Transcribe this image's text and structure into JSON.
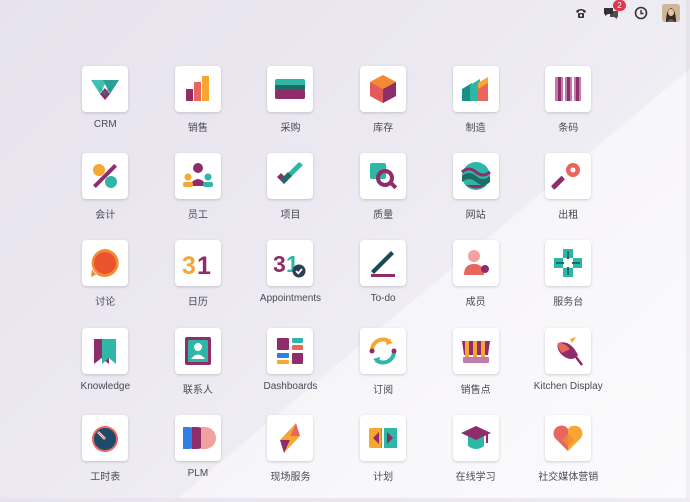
{
  "topbar": {
    "messages_count": "2"
  },
  "apps": [
    {
      "label": "CRM",
      "icon": "crm-icon"
    },
    {
      "label": "销售",
      "icon": "sales-icon"
    },
    {
      "label": "采购",
      "icon": "purchase-icon"
    },
    {
      "label": "库存",
      "icon": "inventory-icon"
    },
    {
      "label": "制造",
      "icon": "manufacturing-icon"
    },
    {
      "label": "条码",
      "icon": "barcode-icon"
    },
    {
      "label": "会计",
      "icon": "accounting-icon"
    },
    {
      "label": "员工",
      "icon": "employees-icon"
    },
    {
      "label": "项目",
      "icon": "project-icon"
    },
    {
      "label": "质量",
      "icon": "quality-icon"
    },
    {
      "label": "网站",
      "icon": "website-icon"
    },
    {
      "label": "出租",
      "icon": "rental-icon"
    },
    {
      "label": "讨论",
      "icon": "discuss-icon"
    },
    {
      "label": "日历",
      "icon": "calendar-icon"
    },
    {
      "label": "Appointments",
      "icon": "appointments-icon"
    },
    {
      "label": "To-do",
      "icon": "todo-icon"
    },
    {
      "label": "成员",
      "icon": "members-icon"
    },
    {
      "label": "服务台",
      "icon": "helpdesk-icon"
    },
    {
      "label": "Knowledge",
      "icon": "knowledge-icon"
    },
    {
      "label": "联系人",
      "icon": "contacts-icon"
    },
    {
      "label": "Dashboards",
      "icon": "dashboards-icon"
    },
    {
      "label": "订阅",
      "icon": "subscriptions-icon"
    },
    {
      "label": "销售点",
      "icon": "point-of-sale-icon"
    },
    {
      "label": "Kitchen Display",
      "icon": "kitchen-display-icon"
    },
    {
      "label": "工时表",
      "icon": "timesheets-icon"
    },
    {
      "label": "PLM",
      "icon": "plm-icon"
    },
    {
      "label": "现场服务",
      "icon": "field-service-icon"
    },
    {
      "label": "计划",
      "icon": "planning-icon"
    },
    {
      "label": "在线学习",
      "icon": "elearning-icon"
    },
    {
      "label": "社交媒体营销",
      "icon": "social-marketing-icon"
    }
  ]
}
